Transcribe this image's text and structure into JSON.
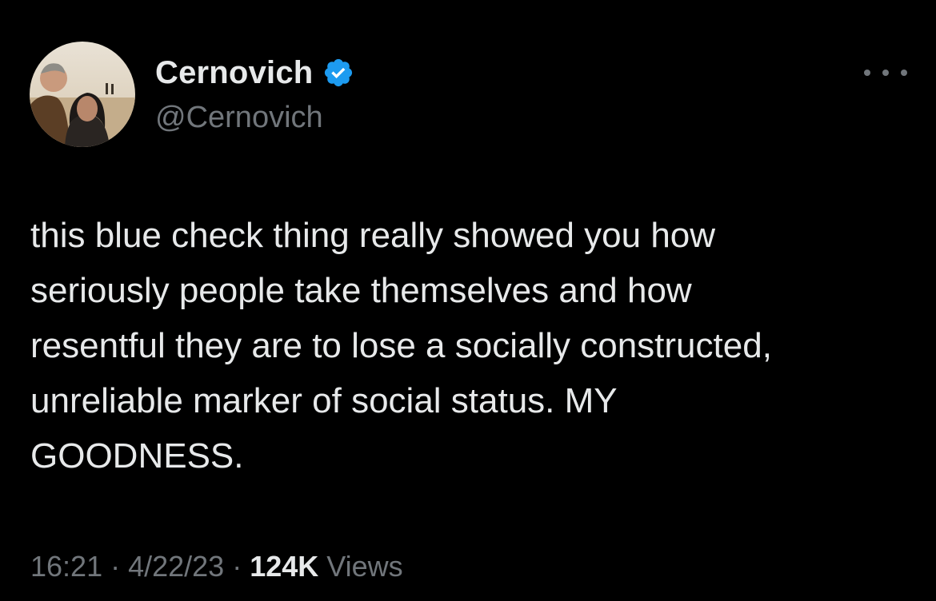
{
  "tweet": {
    "author": {
      "display_name": "Cernovich",
      "handle": "@Cernovich",
      "verified": true,
      "avatar_icon": "user-avatar-photo"
    },
    "more_icon": "more-options-icon",
    "text": "this blue check thing really showed you how\nseriously people take themselves and how\nresentful they are to lose a socially constructed,\nunreliable marker of social status. MY\nGOODNESS.",
    "time": "16:21",
    "separator": "·",
    "date": "4/22/23",
    "views_count": "124K",
    "views_label": "Views"
  },
  "colors": {
    "background": "#000000",
    "primary_text": "#e7e9ea",
    "secondary_text": "#71767b",
    "verified_blue": "#1d9bf0"
  }
}
